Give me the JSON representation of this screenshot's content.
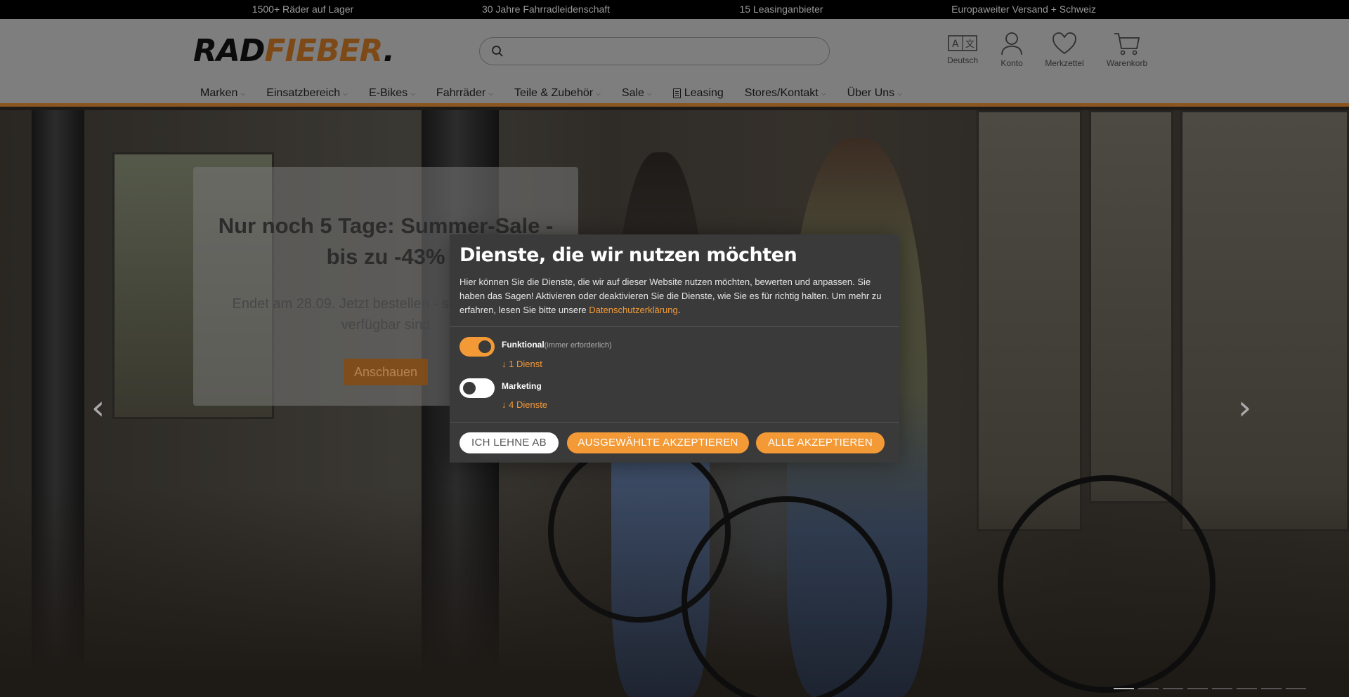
{
  "topbar": {
    "items": [
      "1500+ Räder auf Lager",
      "30 Jahre Fahrradleidenschaft",
      "15 Leasinganbieter",
      "Europaweiter Versand + Schweiz"
    ]
  },
  "header": {
    "logo": {
      "part1": "RAD",
      "part2": "FIEBER",
      "part3": "."
    },
    "search": {
      "placeholder": "",
      "value": ""
    },
    "icons": [
      {
        "icon": "language-icon",
        "label": "Deutsch"
      },
      {
        "icon": "user-icon",
        "label": "Konto"
      },
      {
        "icon": "heart-icon",
        "label": "Merkzettel"
      },
      {
        "icon": "cart-icon",
        "label": "Warenkorb"
      }
    ]
  },
  "nav": {
    "items": [
      "Marken",
      "Einsatzbereich",
      "E-Bikes",
      "Fahrräder",
      "Teile & Zubehör",
      "Sale",
      "Leasing",
      "Stores/Kontakt",
      "Über Uns"
    ],
    "chevron": "⌵"
  },
  "hero": {
    "promo": {
      "title": "Nur noch 5 Tage: Summer-Sale - bis zu -43%",
      "text": "Endet am 28.09. Jetzt bestellen - solange Farben verfügbar sind",
      "button": "Anschauen"
    },
    "prev_arrow": "‹",
    "next_arrow": "›",
    "slide_count": 8,
    "active_slide": 1
  },
  "consent": {
    "title": "Dienste, die wir nutzen möchten",
    "description_1": "Hier können Sie die Dienste, die wir auf dieser Website nutzen möchten, bewerten und anpassen. Sie haben das Sagen! Aktivieren oder deaktivieren Sie die Dienste, wie Sie es für richtig halten. Um mehr zu erfahren, lesen Sie bitte unsere ",
    "privacy_link": "Datenschutzerklärung",
    "description_2": ".",
    "services": [
      {
        "name": "Funktional",
        "note": "(immer erforderlich)",
        "link": "↓ 1 Dienst",
        "enabled": true
      },
      {
        "name": "Marketing",
        "note": "",
        "link": "↓ 4 Dienste",
        "enabled": false
      }
    ],
    "buttons": {
      "decline": "ICH LEHNE AB",
      "accept_selected": "AUSGEWÄHLTE AKZEPTIEREN",
      "accept_all": "ALLE AKZEPTIEREN"
    },
    "colors": {
      "accent": "#f39a36",
      "panel": "#3a3a3a"
    }
  }
}
